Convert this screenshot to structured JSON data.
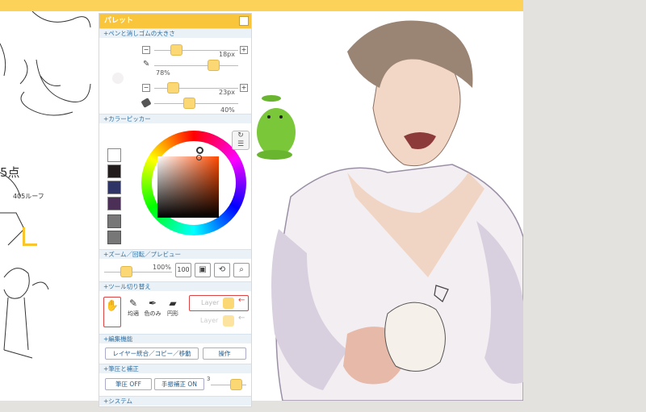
{
  "palette": {
    "title": "パレット",
    "sections": {
      "pen_size": "+ペンと消しゴムの大きさ",
      "color_picker": "+カラーピッカー",
      "zoom": "+ズーム／回転／プレビュー",
      "tool_switch": "+ツール切り替え",
      "edit": "+編集機能",
      "pressure": "+筆圧と補正",
      "system": "+システム"
    },
    "pen": {
      "size": "18px",
      "opacity": "78%",
      "minus": "−",
      "plus": "+"
    },
    "eraser": {
      "size": "23px",
      "opacity": "40%",
      "minus": "−",
      "plus": "+"
    },
    "zoom": {
      "value": "100%",
      "btn_100": "100"
    },
    "tools": [
      {
        "label": ""
      },
      {
        "label": "均適"
      },
      {
        "label": "色のみ"
      },
      {
        "label": "円形"
      }
    ],
    "layers": {
      "layer1": "Layer",
      "layer2": "Layer"
    },
    "edit": {
      "merge_label": "レイヤー統合／コピー／移動",
      "operate_label": "操作"
    },
    "pressure": {
      "pressure_label": "筆圧 OFF",
      "correction_label": "手振補正 ON",
      "value": "3"
    }
  },
  "colors": {
    "accent": "#f9c53b",
    "section_text": "#2d6fa3",
    "swatch_white": "#ffffff",
    "swatch_black": "#221c1c",
    "swatch_navy": "#2e3566",
    "swatch_purple": "#4b2f57"
  },
  "canvas": {
    "sketch_text_1": "5点",
    "sketch_text_2": "405ルーフ"
  }
}
